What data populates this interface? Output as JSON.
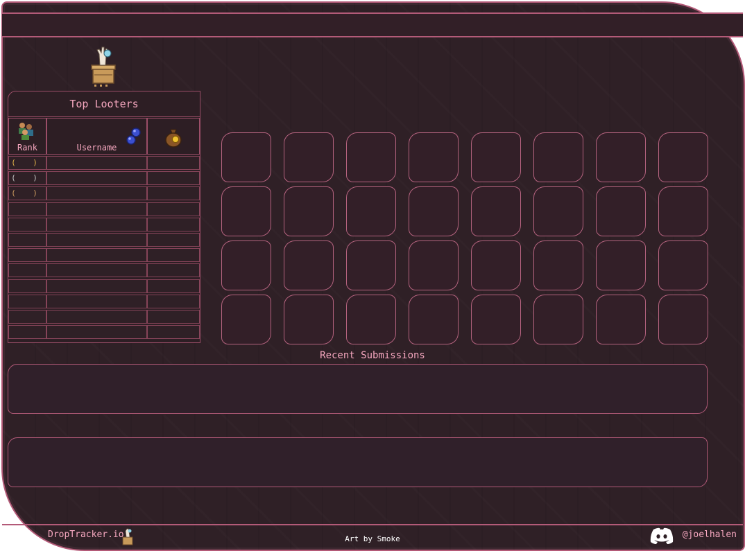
{
  "leaderboard": {
    "title": "Top Looters",
    "columns": [
      {
        "label": "Rank",
        "icon": "players-icon"
      },
      {
        "label": "Username",
        "icon": "orb-icon"
      },
      {
        "label": "",
        "icon": "money-bag-icon"
      }
    ],
    "rows": [
      {
        "rank": "( )",
        "username": "",
        "value": "",
        "color": "#e8b84a"
      },
      {
        "rank": "( )",
        "username": "",
        "value": "",
        "color": "#c9c9c9"
      },
      {
        "rank": "( )",
        "username": "",
        "value": "",
        "color": "#d2a062"
      },
      {
        "rank": "",
        "username": "",
        "value": ""
      },
      {
        "rank": "",
        "username": "",
        "value": ""
      },
      {
        "rank": "",
        "username": "",
        "value": ""
      },
      {
        "rank": "",
        "username": "",
        "value": ""
      },
      {
        "rank": "",
        "username": "",
        "value": ""
      },
      {
        "rank": "",
        "username": "",
        "value": ""
      },
      {
        "rank": "",
        "username": "",
        "value": ""
      },
      {
        "rank": "",
        "username": "",
        "value": ""
      },
      {
        "rank": "",
        "username": "",
        "value": ""
      }
    ]
  },
  "recent": {
    "title": "Recent Submissions"
  },
  "footer": {
    "site": "DropTracker.io",
    "credit": "Art by Smoke",
    "discord_handle": "@joelhalen"
  },
  "colors": {
    "accent": "#b35a78",
    "text": "#f7a8c0",
    "background": "#2f2026"
  }
}
